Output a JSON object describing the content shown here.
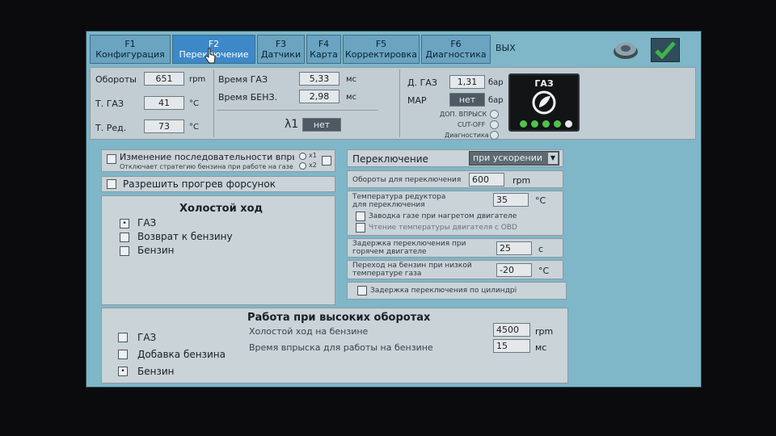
{
  "tabs": [
    {
      "key": "F1",
      "label": "Конфигурация"
    },
    {
      "key": "F2",
      "label": "Переключение"
    },
    {
      "key": "F3",
      "label": "Датчики"
    },
    {
      "key": "F4",
      "label": "Карта"
    },
    {
      "key": "F5",
      "label": "Корректировка"
    },
    {
      "key": "F6",
      "label": "Диагностика"
    },
    {
      "key": "",
      "label": "ВЫХ"
    }
  ],
  "status": {
    "rpm_label": "Обороты",
    "rpm_value": "651",
    "rpm_unit": "rpm",
    "tgas_label": "Т. ГАЗ",
    "tgas_value": "41",
    "tgas_unit": "°C",
    "tred_label": "Т. Ред.",
    "tred_value": "73",
    "tred_unit": "°C",
    "time_gas_label": "Время ГАЗ",
    "time_gas_value": "5,33",
    "time_gas_unit": "мс",
    "time_benz_label": "Время БЕНЗ.",
    "time_benz_value": "2,98",
    "time_benz_unit": "мс",
    "lambda_label": "λ1",
    "lambda_value": "нет",
    "dgas_label": "Д. ГАЗ",
    "dgas_value": "1,31",
    "dgas_unit": "бар",
    "map_label": "MAP",
    "map_value": "нет",
    "map_unit": "бар",
    "ind_extra": "ДОП. ВПРЫСК",
    "ind_cutoff": "CUT-OFF",
    "ind_diag": "Диагностика",
    "logo_label": "ГАЗ"
  },
  "sequence": {
    "label": "Изменение последовательности впрыс",
    "sub": "Отключает стратегию бензина при работе на газе",
    "x1": "x1",
    "x2": "x2"
  },
  "preheat_label": "Разрешить прогрев форсунок",
  "idle": {
    "title": "Холостой ход",
    "options": [
      {
        "label": "ГАЗ",
        "mark": "•"
      },
      {
        "label": "Возврат к бензину",
        "mark": ""
      },
      {
        "label": "Бензин",
        "mark": ""
      }
    ]
  },
  "switch": {
    "label": "Переключение",
    "mode": "при ускорении",
    "rpm_label": "Обороты для переключения",
    "rpm_value": "600",
    "rpm_unit": "rpm",
    "temp_label": "Температура редуктора для переключения",
    "temp_value": "35",
    "temp_unit": "°C",
    "cb_hot_start": "Заводка газе при нагретом двигателе",
    "cb_obd": "Чтение температуры двигателя с OBD",
    "delay_label": "Задержка переключения при горячем двигателе",
    "delay_value": "25",
    "delay_unit": "с",
    "low_temp_label": "Переход на бензин при низкой температуре газа",
    "low_temp_value": "-20",
    "low_temp_unit": "°C",
    "cb_cyl": "Задержка переключения по цилиндрі"
  },
  "high_rpm": {
    "title": "Работа при высоких оборотах",
    "options": [
      {
        "label": "ГАЗ",
        "mark": ""
      },
      {
        "label": "Добавка бензина",
        "mark": ""
      },
      {
        "label": "Бензин",
        "mark": "•"
      }
    ],
    "idle_label": "Холостой ход на бензине",
    "idle_value": "4500",
    "idle_unit": "rpm",
    "time_label": "Время впрыска для работы на бензине",
    "time_value": "15",
    "time_unit": "мс"
  }
}
